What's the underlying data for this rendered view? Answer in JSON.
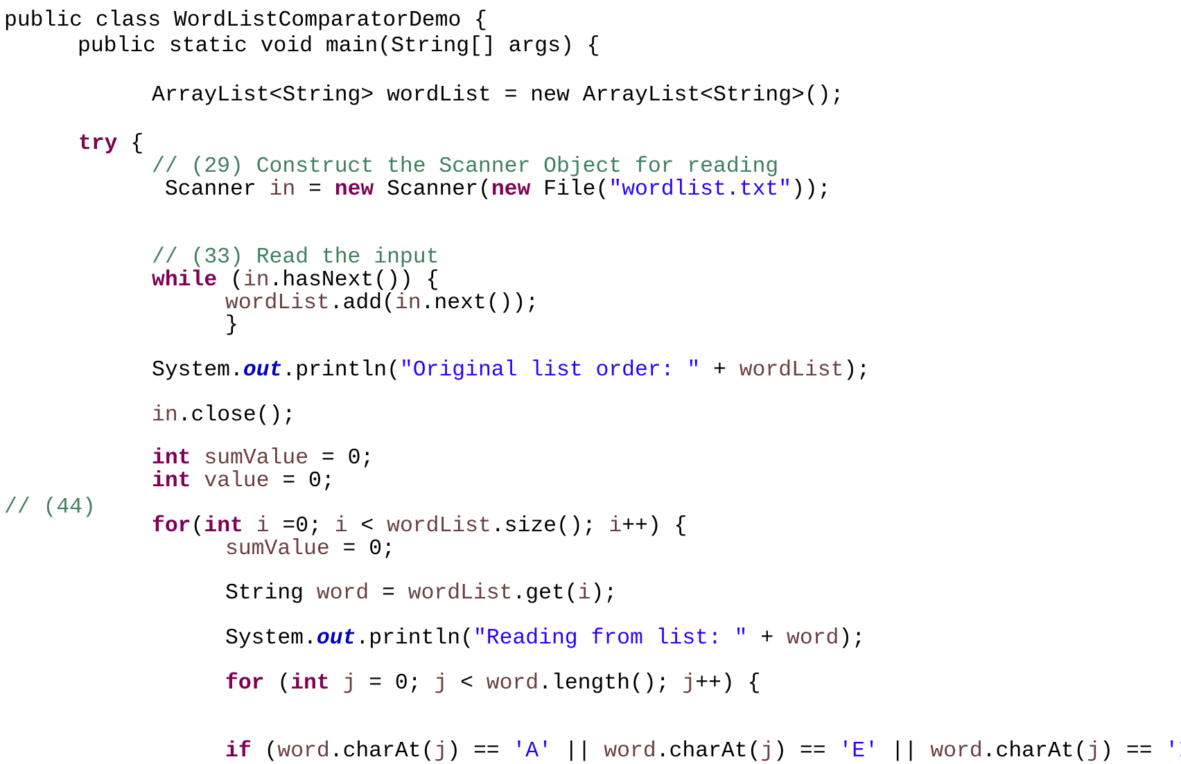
{
  "colors": {
    "keyword": "#7f0055",
    "comment": "#3f7f5f",
    "string": "#2a00ff",
    "local_variable": "#6a3e3e",
    "static_field": "#0000c0",
    "plain": "#000000",
    "background": "#ffffff"
  },
  "code": {
    "language": "Java",
    "lines": [
      {
        "tokens": [
          {
            "t": "plain",
            "v": "public class WordListComparatorDemo {"
          }
        ]
      },
      {
        "tokens": [
          {
            "t": "plain",
            "v": "public static void main(String[] args) {"
          }
        ]
      },
      {
        "tokens": [
          {
            "t": "plain",
            "v": "ArrayList<String> wordList = new ArrayList<String>();"
          }
        ]
      },
      {
        "tokens": [
          {
            "t": "kw",
            "v": "try"
          },
          {
            "t": "plain",
            "v": " {"
          }
        ]
      },
      {
        "tokens": [
          {
            "t": "cm",
            "v": "// (29) Construct the Scanner Object for reading"
          }
        ]
      },
      {
        "tokens": [
          {
            "t": "plain",
            "v": " Scanner "
          },
          {
            "t": "var",
            "v": "in"
          },
          {
            "t": "plain",
            "v": " = "
          },
          {
            "t": "kw",
            "v": "new"
          },
          {
            "t": "plain",
            "v": " Scanner("
          },
          {
            "t": "kw",
            "v": "new"
          },
          {
            "t": "plain",
            "v": " File("
          },
          {
            "t": "str",
            "v": "\"wordlist.txt\""
          },
          {
            "t": "plain",
            "v": "));"
          }
        ]
      },
      {
        "tokens": [
          {
            "t": "cm",
            "v": "// (33) Read the input"
          }
        ]
      },
      {
        "tokens": [
          {
            "t": "kw",
            "v": "while"
          },
          {
            "t": "plain",
            "v": " ("
          },
          {
            "t": "var",
            "v": "in"
          },
          {
            "t": "plain",
            "v": ".hasNext()) {"
          }
        ]
      },
      {
        "tokens": [
          {
            "t": "var",
            "v": "wordList"
          },
          {
            "t": "plain",
            "v": ".add("
          },
          {
            "t": "var",
            "v": "in"
          },
          {
            "t": "plain",
            "v": ".next());"
          }
        ]
      },
      {
        "tokens": [
          {
            "t": "plain",
            "v": "}"
          }
        ]
      },
      {
        "tokens": [
          {
            "t": "plain",
            "v": "System."
          },
          {
            "t": "field",
            "v": "out"
          },
          {
            "t": "plain",
            "v": ".println("
          },
          {
            "t": "str",
            "v": "\"Original list order: \""
          },
          {
            "t": "plain",
            "v": " + "
          },
          {
            "t": "var",
            "v": "wordList"
          },
          {
            "t": "plain",
            "v": ");"
          }
        ]
      },
      {
        "tokens": [
          {
            "t": "var",
            "v": "in"
          },
          {
            "t": "plain",
            "v": ".close();"
          }
        ]
      },
      {
        "tokens": [
          {
            "t": "kw",
            "v": "int"
          },
          {
            "t": "plain",
            "v": " "
          },
          {
            "t": "var",
            "v": "sumValue"
          },
          {
            "t": "plain",
            "v": " = 0;"
          }
        ]
      },
      {
        "tokens": [
          {
            "t": "kw",
            "v": "int"
          },
          {
            "t": "plain",
            "v": " "
          },
          {
            "t": "var",
            "v": "value"
          },
          {
            "t": "plain",
            "v": " = 0;"
          }
        ]
      },
      {
        "tokens": [
          {
            "t": "cm",
            "v": "// (44)"
          }
        ]
      },
      {
        "tokens": [
          {
            "t": "kw",
            "v": "for"
          },
          {
            "t": "plain",
            "v": "("
          },
          {
            "t": "kw",
            "v": "int"
          },
          {
            "t": "plain",
            "v": " "
          },
          {
            "t": "var",
            "v": "i"
          },
          {
            "t": "plain",
            "v": " =0; "
          },
          {
            "t": "var",
            "v": "i"
          },
          {
            "t": "plain",
            "v": " < "
          },
          {
            "t": "var",
            "v": "wordList"
          },
          {
            "t": "plain",
            "v": ".size(); "
          },
          {
            "t": "var",
            "v": "i"
          },
          {
            "t": "plain",
            "v": "++) {"
          }
        ]
      },
      {
        "tokens": [
          {
            "t": "var",
            "v": "sumValue"
          },
          {
            "t": "plain",
            "v": " = 0;"
          }
        ]
      },
      {
        "tokens": [
          {
            "t": "plain",
            "v": "String "
          },
          {
            "t": "var",
            "v": "word"
          },
          {
            "t": "plain",
            "v": " = "
          },
          {
            "t": "var",
            "v": "wordList"
          },
          {
            "t": "plain",
            "v": ".get("
          },
          {
            "t": "var",
            "v": "i"
          },
          {
            "t": "plain",
            "v": ");"
          }
        ]
      },
      {
        "tokens": [
          {
            "t": "plain",
            "v": "System."
          },
          {
            "t": "field",
            "v": "out"
          },
          {
            "t": "plain",
            "v": ".println("
          },
          {
            "t": "str",
            "v": "\"Reading from list: \""
          },
          {
            "t": "plain",
            "v": " + "
          },
          {
            "t": "var",
            "v": "word"
          },
          {
            "t": "plain",
            "v": ");"
          }
        ]
      },
      {
        "tokens": [
          {
            "t": "kw",
            "v": "for"
          },
          {
            "t": "plain",
            "v": " ("
          },
          {
            "t": "kw",
            "v": "int"
          },
          {
            "t": "plain",
            "v": " "
          },
          {
            "t": "var",
            "v": "j"
          },
          {
            "t": "plain",
            "v": " = 0; "
          },
          {
            "t": "var",
            "v": "j"
          },
          {
            "t": "plain",
            "v": " < "
          },
          {
            "t": "var",
            "v": "word"
          },
          {
            "t": "plain",
            "v": ".length(); "
          },
          {
            "t": "var",
            "v": "j"
          },
          {
            "t": "plain",
            "v": "++) {"
          }
        ]
      },
      {
        "tokens": [
          {
            "t": "kw",
            "v": "if"
          },
          {
            "t": "plain",
            "v": " ("
          },
          {
            "t": "var",
            "v": "word"
          },
          {
            "t": "plain",
            "v": ".charAt("
          },
          {
            "t": "var",
            "v": "j"
          },
          {
            "t": "plain",
            "v": ") == "
          },
          {
            "t": "str",
            "v": "'A'"
          },
          {
            "t": "plain",
            "v": " || "
          },
          {
            "t": "var",
            "v": "word"
          },
          {
            "t": "plain",
            "v": ".charAt("
          },
          {
            "t": "var",
            "v": "j"
          },
          {
            "t": "plain",
            "v": ") == "
          },
          {
            "t": "str",
            "v": "'E'"
          },
          {
            "t": "plain",
            "v": " || "
          },
          {
            "t": "var",
            "v": "word"
          },
          {
            "t": "plain",
            "v": ".charAt("
          },
          {
            "t": "var",
            "v": "j"
          },
          {
            "t": "plain",
            "v": ") == "
          },
          {
            "t": "str",
            "v": "'I'"
          },
          {
            "t": "plain",
            "v": " ||"
          }
        ]
      }
    ]
  }
}
